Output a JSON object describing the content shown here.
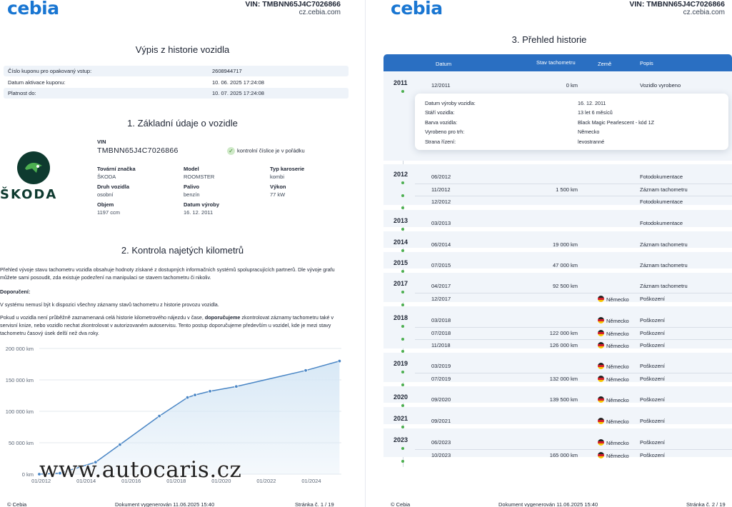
{
  "header": {
    "logo": "cebia",
    "vin_line": "VIN: TMBNN65J4C7026866",
    "site": "cz.cebia.com"
  },
  "page1": {
    "title": "Výpis z historie vozidla",
    "coupon": [
      {
        "key": "Číslo kuponu pro opakovaný vstup:",
        "value": "2608944717"
      },
      {
        "key": "Datum aktivace kuponu:",
        "value": "10. 06. 2025 17:24:08"
      },
      {
        "key": "Platnost do:",
        "value": "10. 07. 2025 17:24:08"
      }
    ],
    "section1_title": "1. Základní údaje o vozidle",
    "brand_logo_text": "ŠKODA",
    "vin_label": "VIN",
    "vin_value": "TMBNN65J4C7026866",
    "check_text": "kontrolní číslice je v pořádku",
    "specs": [
      {
        "key": "Tovární značka",
        "value": "ŠKODA"
      },
      {
        "key": "Model",
        "value": "ROOMSTER"
      },
      {
        "key": "Typ karoserie",
        "value": "kombi"
      },
      {
        "key": "Druh vozidla",
        "value": "osobní"
      },
      {
        "key": "Palivo",
        "value": "benzín"
      },
      {
        "key": "Výkon",
        "value": "77 kW"
      },
      {
        "key": "Objem",
        "value": "1197 ccm"
      },
      {
        "key": "Datum výroby",
        "value": "16. 12. 2011"
      }
    ],
    "section2_title": "2. Kontrola najetých kilometrů",
    "para1": "Přehled vývoje stavu tachometru vozidla obsahuje hodnoty získané z dostupných informačních systémů spolupracujících partnerů. Dle vývoje grafu můžete sami posoudit, zda existuje podezření na manipulaci se stavem tachometru či nikoliv.",
    "recommend_label": "Doporučení:",
    "para2": "V systému nemusí být k dispozici všechny záznamy stavů tachometru z historie provozu vozidla.",
    "para3_a": "Pokud u vozidla není průběžně zaznamenaná celá historie kilometrového nájezdu v čase, ",
    "para3_b": "doporučujeme",
    "para3_c": " zkontrolovat záznamy tachometru také v servisní knize, nebo vozidlo nechat zkontrolovat v autorizovaném autoservisu. Tento postup doporučujeme především u vozidel, kde je mezi stavy tachometru časový úsek delší než dva roky.",
    "watermark": "www.autocaris.cz",
    "footer_left": "© Cebia",
    "footer_mid": "Dokument vygenerován 11.06.2025 15:40",
    "footer_right": "Stránka č. 1 / 19"
  },
  "chart_data": {
    "type": "area",
    "title": "",
    "xlabel": "",
    "ylabel": "",
    "x_ticks": [
      "01/2012",
      "01/2014",
      "01/2016",
      "01/2018",
      "01/2020",
      "01/2022",
      "01/2024"
    ],
    "y_ticks": [
      "0 km",
      "50 000 km",
      "100 000 km",
      "150 000 km",
      "200 000 km"
    ],
    "ylim": [
      0,
      200000
    ],
    "xlim": [
      "2011-12",
      "2025-05"
    ],
    "grid": true,
    "line_color": "#4a86c5",
    "fill_color": "#d6e7f5",
    "series": [
      {
        "points": [
          {
            "x": "2011-12",
            "y": 0
          },
          {
            "x": "2012-11",
            "y": 1500
          },
          {
            "x": "2014-06",
            "y": 19000
          },
          {
            "x": "2015-07",
            "y": 47000
          },
          {
            "x": "2017-04",
            "y": 92500
          },
          {
            "x": "2018-07",
            "y": 122000
          },
          {
            "x": "2018-11",
            "y": 126000
          },
          {
            "x": "2019-07",
            "y": 132000
          },
          {
            "x": "2020-09",
            "y": 139500
          },
          {
            "x": "2023-10",
            "y": 165000
          },
          {
            "x": "2025-04",
            "y": 180000
          }
        ]
      }
    ]
  },
  "page2": {
    "title": "3. Přehled historie",
    "columns": [
      "Datum",
      "Stav tachometru",
      "Země",
      "Popis"
    ],
    "detail": [
      {
        "key": "Datum výroby vozidla:",
        "value": "16. 12. 2011"
      },
      {
        "key": "Stáří vozidla:",
        "value": "13 let 6 měsíců"
      },
      {
        "key": "Barva vozidla:",
        "value": "Black Magic Pearlescent - kód 1Z"
      },
      {
        "key": "Vyrobeno pro trh:",
        "value": "Německo"
      },
      {
        "key": "Strana řízení:",
        "value": "levostranné"
      }
    ],
    "years": [
      {
        "year": "2011",
        "rows": [
          {
            "date": "12/2011",
            "km": "0 km",
            "country": "",
            "desc": "Vozidlo vyrobeno"
          }
        ]
      },
      {
        "year": "2012",
        "rows": [
          {
            "date": "06/2012",
            "km": "",
            "country": "",
            "desc": "Fotodokumentace"
          },
          {
            "date": "11/2012",
            "km": "1 500 km",
            "country": "",
            "desc": "Záznam tachometru"
          },
          {
            "date": "12/2012",
            "km": "",
            "country": "",
            "desc": "Fotodokumentace"
          }
        ]
      },
      {
        "year": "2013",
        "rows": [
          {
            "date": "03/2013",
            "km": "",
            "country": "",
            "desc": "Fotodokumentace"
          }
        ]
      },
      {
        "year": "2014",
        "rows": [
          {
            "date": "06/2014",
            "km": "19 000 km",
            "country": "",
            "desc": "Záznam tachometru"
          }
        ]
      },
      {
        "year": "2015",
        "rows": [
          {
            "date": "07/2015",
            "km": "47 000 km",
            "country": "",
            "desc": "Záznam tachometru"
          }
        ]
      },
      {
        "year": "2017",
        "rows": [
          {
            "date": "04/2017",
            "km": "92 500 km",
            "country": "",
            "desc": "Záznam tachometru"
          },
          {
            "date": "12/2017",
            "km": "",
            "country": "Německo",
            "desc": "Poškození"
          }
        ]
      },
      {
        "year": "2018",
        "rows": [
          {
            "date": "03/2018",
            "km": "",
            "country": "Německo",
            "desc": "Poškození"
          },
          {
            "date": "07/2018",
            "km": "122 000 km",
            "country": "Německo",
            "desc": "Poškození"
          },
          {
            "date": "11/2018",
            "km": "126 000 km",
            "country": "Německo",
            "desc": "Poškození"
          }
        ]
      },
      {
        "year": "2019",
        "rows": [
          {
            "date": "03/2019",
            "km": "",
            "country": "Německo",
            "desc": "Poškození"
          },
          {
            "date": "07/2019",
            "km": "132 000 km",
            "country": "Německo",
            "desc": "Poškození"
          }
        ]
      },
      {
        "year": "2020",
        "rows": [
          {
            "date": "09/2020",
            "km": "139 500 km",
            "country": "Německo",
            "desc": "Poškození"
          }
        ]
      },
      {
        "year": "2021",
        "rows": [
          {
            "date": "09/2021",
            "km": "",
            "country": "Německo",
            "desc": "Poškození"
          }
        ]
      },
      {
        "year": "2023",
        "rows": [
          {
            "date": "06/2023",
            "km": "",
            "country": "Německo",
            "desc": "Poškození"
          },
          {
            "date": "10/2023",
            "km": "165 000 km",
            "country": "Německo",
            "desc": "Poškození"
          }
        ]
      }
    ],
    "footer_left": "© Cebia",
    "footer_mid": "Dokument vygenerován 11.06.2025 15:40",
    "footer_right": "Stránka č. 2 / 19"
  },
  "colors": {
    "brand_blue": "#1976d2",
    "table_header": "#2a6fc2",
    "skoda_green": "#0e3a2f",
    "timeline_dot": "#4caf50"
  },
  "icons": [
    "check-icon",
    "skoda-logo-icon",
    "germany-flag-icon"
  ]
}
